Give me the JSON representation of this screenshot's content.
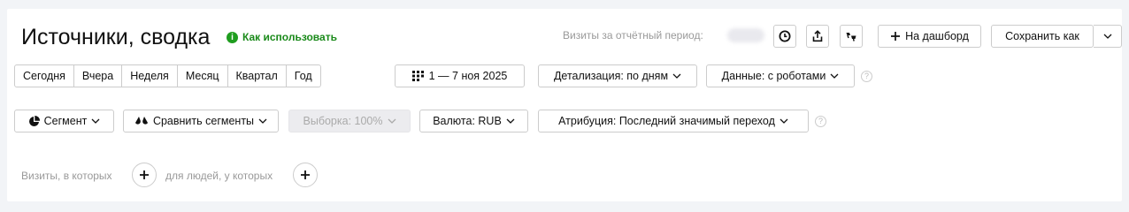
{
  "header": {
    "title": "Источники, сводка",
    "howto_label": "Как использовать",
    "visits_label": "Визиты за отчётный период:",
    "dashboard_label": "На дашборд",
    "save_as_label": "Сохранить как"
  },
  "period": {
    "presets": [
      "Сегодня",
      "Вчера",
      "Неделя",
      "Месяц",
      "Квартал",
      "Год"
    ],
    "date_range": "1 — 7 ноя 2025",
    "detail": "Детализация: по дням",
    "data_filter": "Данные: с роботами"
  },
  "segments": {
    "segment_label": "Сегмент",
    "compare_label": "Сравнить сегменты",
    "sample_label": "Выборка: 100%",
    "currency_label": "Валюта: RUB",
    "attribution_label": "Атрибуция: Последний значимый переход"
  },
  "filters": {
    "visits_where": "Визиты, в которых",
    "people_where": "для людей, у которых"
  },
  "colors": {
    "accent_green": "#1f9d1f",
    "border": "#cccccc",
    "muted_text": "#999999"
  }
}
